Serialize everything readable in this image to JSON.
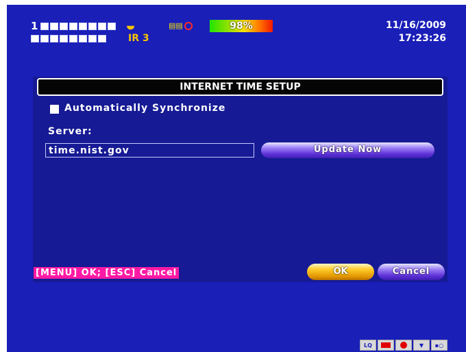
{
  "header": {
    "channel_prefix": "1",
    "ir_label": "IR 3",
    "hdd_icon": "hdd-icon",
    "storage_percent": "98%",
    "date": "11/16/2009",
    "time": "17:23:26"
  },
  "dialog": {
    "title": "INTERNET TIME SETUP",
    "auto_sync_label": "Automatically Synchronize",
    "auto_sync_checked": false,
    "server_label": "Server:",
    "server_value": "time.nist.gov",
    "update_button": "Update Now",
    "hint": "[MENU] OK; [ESC] Cancel",
    "ok_button": "OK",
    "cancel_button": "Cancel"
  },
  "bottom_bar": {
    "quality_label": "LQ"
  },
  "colors": {
    "background": "#1a1fb8",
    "dialog": "#161a94",
    "hint": "#ff1aa5",
    "ok": "#ffcc2a",
    "button_purple": "#5c2fd6"
  }
}
